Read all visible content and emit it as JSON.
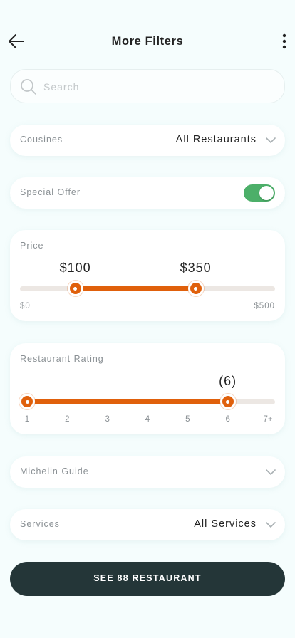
{
  "header": {
    "title": "More Filters"
  },
  "search": {
    "placeholder": "Search",
    "value": ""
  },
  "cuisines": {
    "label": "Cousines",
    "value": "All Restaurants"
  },
  "special_offer": {
    "label": "Special Offer",
    "enabled": true
  },
  "price": {
    "label": "Price",
    "low_label": "$100",
    "high_label": "$350",
    "low": 100,
    "high": 350,
    "min": 0,
    "max": 500,
    "min_label": "$0",
    "max_label": "$500"
  },
  "rating": {
    "label": "Restaurant Rating",
    "selected_label": "(6)",
    "low": 1,
    "high": 6,
    "ticks": [
      "1",
      "2",
      "3",
      "4",
      "5",
      "6",
      "7+"
    ]
  },
  "michelin": {
    "label": "Michelin Guide"
  },
  "services": {
    "label": "Services",
    "value": "All Services"
  },
  "cta": {
    "label": "SEE 88 RESTAURANT"
  },
  "colors": {
    "accent": "#e0600b",
    "toggle_on": "#4caf69",
    "cta_bg": "#243638",
    "track": "#ece7e3"
  },
  "icons": {
    "back": "arrow-left-icon",
    "more": "more-vertical-icon",
    "search": "search-icon",
    "chevron": "chevron-down-icon"
  }
}
